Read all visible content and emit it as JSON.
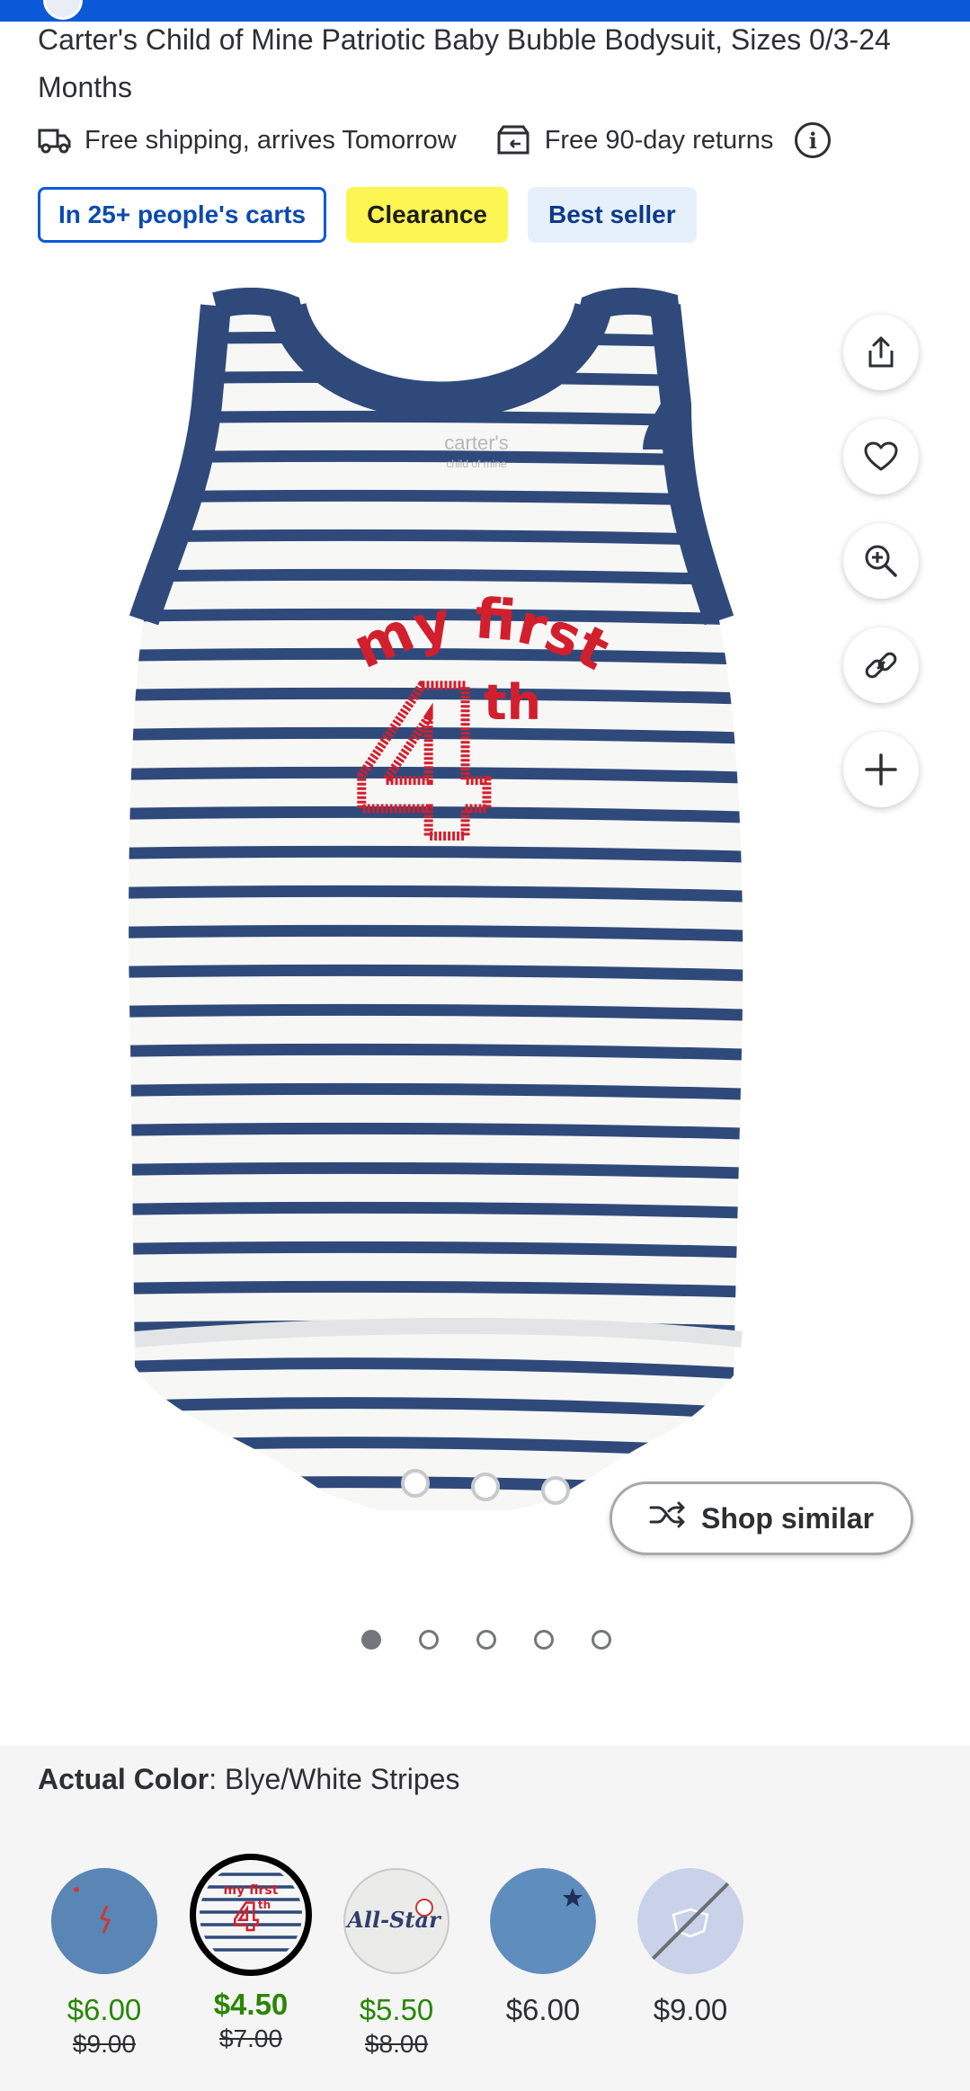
{
  "product": {
    "title": "Carter's Child of Mine Patriotic Baby Bubble Bodysuit, Sizes 0/3-24 Months"
  },
  "fulfillment": {
    "shipping_text": "Free shipping, arrives Tomorrow",
    "returns_text": "Free 90-day returns",
    "info_glyph": "i"
  },
  "badges": {
    "carts": "In 25+ people's carts",
    "clearance": "Clearance",
    "best_seller": "Best seller"
  },
  "actions": {
    "shop_similar": "Shop similar",
    "icons": [
      "share-icon",
      "heart-icon",
      "zoom-in-icon",
      "link-icon",
      "plus-icon"
    ]
  },
  "carousel": {
    "total": 5,
    "active_index": 0
  },
  "image_text": {
    "brand": "carter's",
    "brand_sub": "child of mine",
    "phrase": "my first",
    "number": "4",
    "suffix": "th"
  },
  "color": {
    "label": "Actual Color",
    "value": "Blye/White Stripes",
    "swatches": [
      {
        "price": "$6.00",
        "was": "$9.00",
        "style": "sale",
        "selected": false,
        "available": true
      },
      {
        "price": "$4.50",
        "was": "$7.00",
        "style": "sale-bold",
        "selected": true,
        "available": true,
        "thumb_text": "my first",
        "thumb_number": "4",
        "thumb_suffix": "th"
      },
      {
        "price": "$5.50",
        "was": "$8.00",
        "style": "sale",
        "selected": false,
        "available": true,
        "thumb_text": "All-Star"
      },
      {
        "price": "$6.00",
        "was": "",
        "style": "regular",
        "selected": false,
        "available": true
      },
      {
        "price": "$9.00",
        "was": "",
        "style": "regular",
        "selected": false,
        "available": false
      }
    ]
  },
  "colors": {
    "brand_blue": "#0a5ad8",
    "sale_green": "#2a8703",
    "clearance_yellow": "#fdf551",
    "stripe_navy": "#2f4a7a",
    "print_red": "#d21f2e"
  }
}
